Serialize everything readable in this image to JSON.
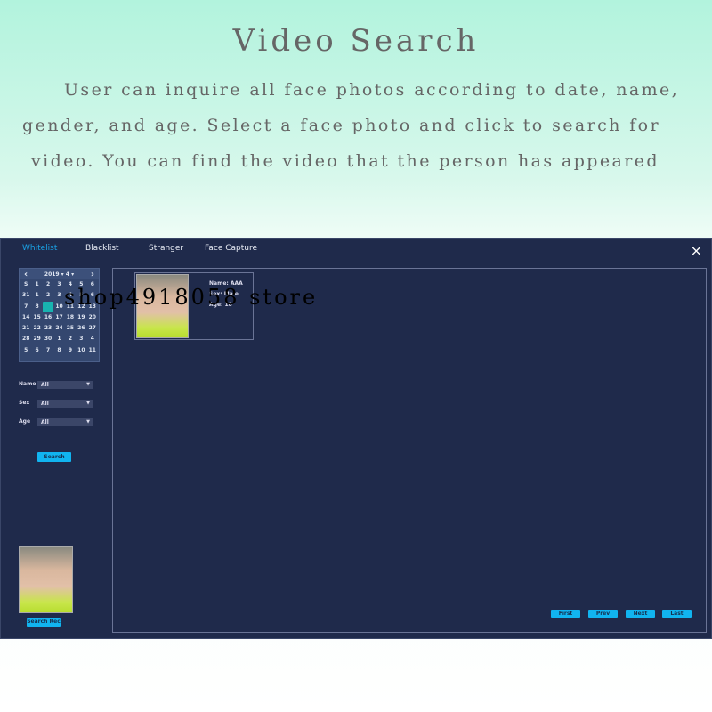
{
  "header": {
    "title": "Video Search",
    "lines": [
      "User can inquire all face photos according to date, name,",
      "gender, and age. Select a face photo and click to search for",
      "video. You can find the video that the person has appeared"
    ]
  },
  "tabs": [
    {
      "label": "Whitelist",
      "active": true
    },
    {
      "label": "Blacklist"
    },
    {
      "label": "Stranger"
    },
    {
      "label": "Face Capture"
    }
  ],
  "close_icon": "×",
  "calendar": {
    "year": "2019",
    "month": "4",
    "prev": "‹",
    "next": "›",
    "selected": "9",
    "cells": [
      "S",
      "1",
      "2",
      "3",
      "4",
      "5",
      "6",
      "31",
      "1",
      "2",
      "3",
      "4",
      "5",
      "6",
      "7",
      "8",
      "9",
      "10",
      "11",
      "12",
      "13",
      "14",
      "15",
      "16",
      "17",
      "18",
      "19",
      "20",
      "21",
      "22",
      "23",
      "24",
      "25",
      "26",
      "27",
      "28",
      "29",
      "30",
      "1",
      "2",
      "3",
      "4",
      "5",
      "6",
      "7",
      "8",
      "9",
      "10",
      "11"
    ]
  },
  "filters": [
    {
      "label": "Name",
      "value": "All"
    },
    {
      "label": "Sex",
      "value": "All"
    },
    {
      "label": "Age",
      "value": "All"
    }
  ],
  "search_label": "Search",
  "result": {
    "name": "Name: AAA",
    "sex": "Sex: Male",
    "age": "Age: 18"
  },
  "search_rec_label": "Search Rec",
  "pager": [
    "First",
    "Prev",
    "Next",
    "Last"
  ],
  "watermark": "shop4918058 store",
  "colors": {
    "panel": "#1f2a4b",
    "accent": "#11b4f0",
    "tab_active": "#1aa4e8",
    "selected_day": "#18b3b0"
  }
}
